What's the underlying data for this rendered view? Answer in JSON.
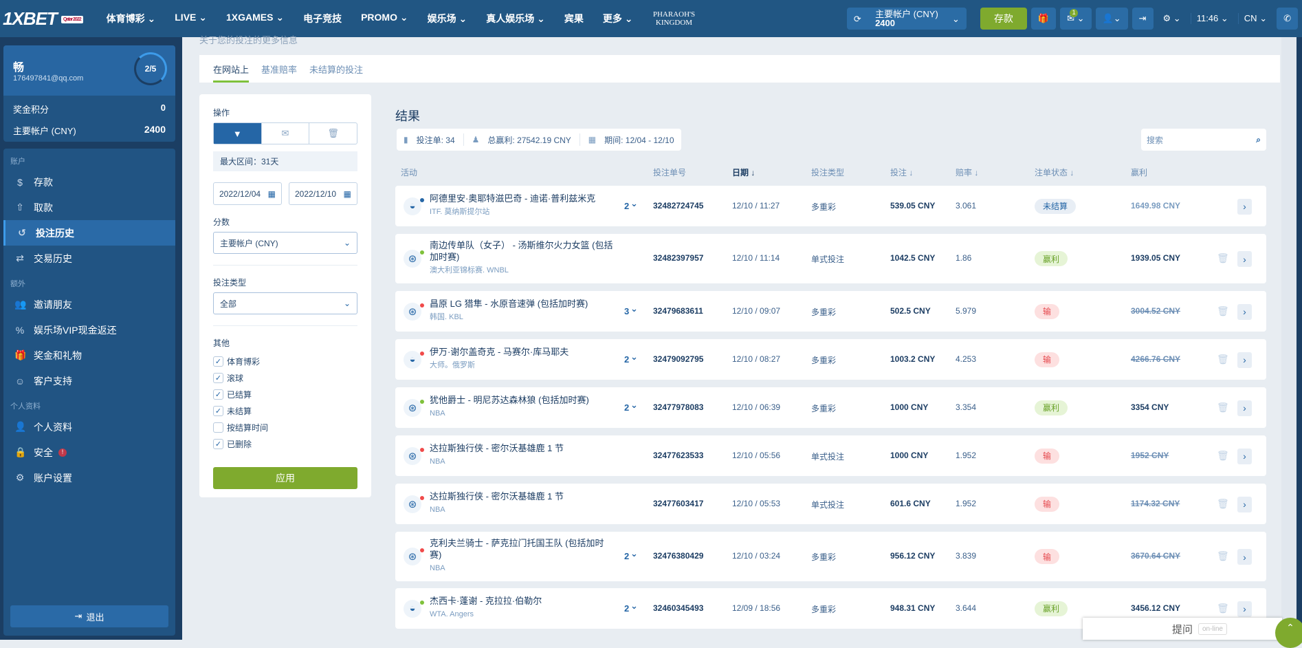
{
  "header": {
    "logo": "1XBET",
    "logo_badge": "Qatar 2022",
    "nav": [
      "体育博彩",
      "LIVE",
      "1XGAMES",
      "电子竞技",
      "PROMO",
      "娱乐场",
      "真人娱乐场",
      "宾果",
      "更多"
    ],
    "nav_dropdown": [
      true,
      true,
      true,
      false,
      true,
      true,
      true,
      false,
      true
    ],
    "promo_logo": "PHARAOH'S KINGDOM",
    "account_label": "主要帐户 (CNY)",
    "account_balance": "2400",
    "deposit": "存款",
    "mail_count": "1",
    "time": "11:46",
    "lang": "CN"
  },
  "user": {
    "name": "畅",
    "email": "176497841@qq.com",
    "level": "2/5",
    "level_progress": 0.4,
    "bonus_label": "奖金积分",
    "bonus_value": "0",
    "main_label": "主要帐户 (CNY)",
    "main_value": "2400"
  },
  "menu": {
    "sections": [
      {
        "title": "账户",
        "items": [
          {
            "label": "存款",
            "icon": "dollar-icon"
          },
          {
            "label": "取款",
            "icon": "upload-icon"
          },
          {
            "label": "投注历史",
            "icon": "history-icon",
            "active": true
          },
          {
            "label": "交易历史",
            "icon": "transfer-icon"
          }
        ]
      },
      {
        "title": "额外",
        "items": [
          {
            "label": "邀请朋友",
            "icon": "users-icon"
          },
          {
            "label": "娱乐场VIP现金返还",
            "icon": "percent-icon"
          },
          {
            "label": "奖金和礼物",
            "icon": "gift-icon"
          },
          {
            "label": "客户支持",
            "icon": "support-icon"
          }
        ]
      },
      {
        "title": "个人资料",
        "items": [
          {
            "label": "个人资料",
            "icon": "user-icon"
          },
          {
            "label": "安全",
            "icon": "lock-icon",
            "alert": true
          },
          {
            "label": "账户设置",
            "icon": "gear-icon"
          }
        ]
      }
    ],
    "logout": "退出"
  },
  "page": {
    "subtitle": "关于您的投注的更多信息",
    "tabs": [
      "在网站上",
      "基准赔率",
      "未结算的投注"
    ],
    "active_tab": 0
  },
  "filter": {
    "operation_label": "操作",
    "max_range": "最大区间：31天",
    "date_from": "2022/12/04",
    "date_to": "2022/12/10",
    "score_label": "分数",
    "score_value": "主要帐户 (CNY)",
    "bet_type_label": "投注类型",
    "bet_type_value": "全部",
    "other_label": "其他",
    "checkboxes": [
      {
        "label": "体育博彩",
        "checked": true
      },
      {
        "label": "滚球",
        "checked": true
      },
      {
        "label": "已结算",
        "checked": true
      },
      {
        "label": "未结算",
        "checked": true
      },
      {
        "label": "按结算时间",
        "checked": false
      },
      {
        "label": "已删除",
        "checked": true
      }
    ],
    "apply": "应用"
  },
  "results": {
    "title": "结果",
    "bets_label": "投注单: 34",
    "profit_label": "总赢利: 27542.19 CNY",
    "period_label": "期间: 12/04 - 12/10",
    "search_placeholder": "搜索",
    "columns": [
      "活动",
      "投注单号",
      "日期 ↓",
      "投注类型",
      "投注 ↓",
      "赔率 ↓",
      "注单状态 ↓",
      "赢利"
    ],
    "rows": [
      {
        "event": "阿德里安·奥耶特滋巴奇 - 迪诺·普利兹米克",
        "league": "ITF. 莫纳斯提尔站",
        "sport": "tennis",
        "count": "2",
        "id": "32482724745",
        "date": "12/10 / 11:27",
        "type": "多重彩",
        "stake": "539.05 CNY",
        "odds": "3.061",
        "status": "未结算",
        "status_kind": "open",
        "win": "1649.98 CNY"
      },
      {
        "event": "南边传单队（女子） - 汤斯维尔火力女篮 (包括加时赛)",
        "league": "澳大利亚锦标赛. WNBL",
        "sport": "basketball",
        "count": "",
        "id": "32482397957",
        "date": "12/10 / 11:14",
        "type": "单式投注",
        "stake": "1042.5 CNY",
        "odds": "1.86",
        "status": "赢利",
        "status_kind": "won",
        "win": "1939.05 CNY"
      },
      {
        "event": "昌原 LG 猎隼 - 水原音速弹 (包括加时赛)",
        "league": "韩国. KBL",
        "sport": "basketball",
        "count": "3",
        "id": "32479683611",
        "date": "12/10 / 09:07",
        "type": "多重彩",
        "stake": "502.5 CNY",
        "odds": "5.979",
        "status": "输",
        "status_kind": "lost",
        "win": "3004.52 CNY"
      },
      {
        "event": "伊万·谢尔盖奇克 - 马赛尔·库马耶夫",
        "league": "大师。俄罗斯",
        "sport": "tennis",
        "count": "2",
        "id": "32479092795",
        "date": "12/10 / 08:27",
        "type": "多重彩",
        "stake": "1003.2 CNY",
        "odds": "4.253",
        "status": "输",
        "status_kind": "lost",
        "win": "4266.76 CNY"
      },
      {
        "event": "犹他爵士 - 明尼苏达森林狼 (包括加时赛)",
        "league": "NBA",
        "sport": "basketball",
        "count": "2",
        "id": "32477978083",
        "date": "12/10 / 06:39",
        "type": "多重彩",
        "stake": "1000 CNY",
        "odds": "3.354",
        "status": "赢利",
        "status_kind": "won",
        "win": "3354 CNY"
      },
      {
        "event": "达拉斯独行侠 - 密尔沃基雄鹿 1 节",
        "league": "NBA",
        "sport": "basketball",
        "count": "",
        "id": "32477623533",
        "date": "12/10 / 05:56",
        "type": "单式投注",
        "stake": "1000 CNY",
        "odds": "1.952",
        "status": "输",
        "status_kind": "lost",
        "win": "1952 CNY"
      },
      {
        "event": "达拉斯独行侠 - 密尔沃基雄鹿 1 节",
        "league": "NBA",
        "sport": "basketball",
        "count": "",
        "id": "32477603417",
        "date": "12/10 / 05:53",
        "type": "单式投注",
        "stake": "601.6 CNY",
        "odds": "1.952",
        "status": "输",
        "status_kind": "lost",
        "win": "1174.32 CNY"
      },
      {
        "event": "克利夫兰骑士 - 萨克拉门托国王队 (包括加时赛)",
        "league": "NBA",
        "sport": "basketball",
        "count": "2",
        "id": "32476380429",
        "date": "12/10 / 03:24",
        "type": "多重彩",
        "stake": "956.12 CNY",
        "odds": "3.839",
        "status": "输",
        "status_kind": "lost",
        "win": "3670.64 CNY"
      },
      {
        "event": "杰西卡·蓬谢 - 克拉拉·伯勒尔",
        "league": "WTA. Angers",
        "sport": "tennis",
        "count": "2",
        "id": "32460345493",
        "date": "12/09 / 18:56",
        "type": "多重彩",
        "stake": "948.31 CNY",
        "odds": "3.644",
        "status": "赢利",
        "status_kind": "won",
        "win": "3456.12 CNY"
      }
    ]
  },
  "chat": {
    "label": "提问",
    "status": "on-line"
  },
  "colors": {
    "header": "#215683",
    "accent_green": "#7faa2e",
    "won": "#6aa22a",
    "lost": "#e5484d",
    "open": "#2566a6"
  }
}
